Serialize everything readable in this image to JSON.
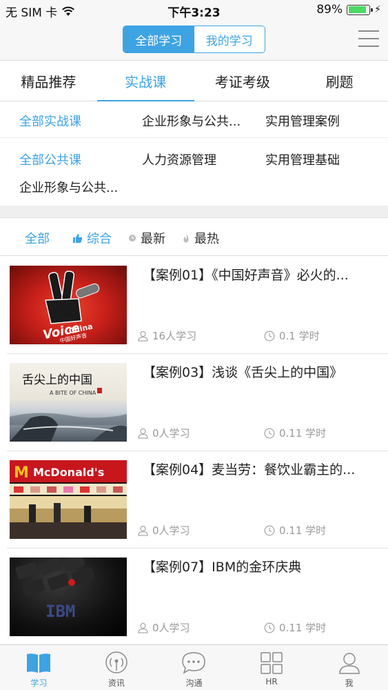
{
  "status_bar": {
    "carrier": "无 SIM 卡",
    "time": "下午3:23",
    "battery_percent": "89%",
    "battery_level": 0.89
  },
  "header": {
    "segment_all": "全部学习",
    "segment_mine": "我的学习",
    "menu_icon": "hamburger-icon"
  },
  "tabs": [
    {
      "label": "精品推荐"
    },
    {
      "label": "实战课"
    },
    {
      "label": "考证考级"
    },
    {
      "label": "刷题"
    }
  ],
  "subcategories": {
    "row1": [
      "全部实战课",
      "企业形象与公共...",
      "实用管理案例"
    ],
    "row2": [
      "全部公共课",
      "人力资源管理",
      "实用管理基础"
    ],
    "row3": [
      "企业形象与公共..."
    ]
  },
  "sort": {
    "all": "全部",
    "comprehensive": "综合",
    "newest": "最新",
    "hottest": "最热"
  },
  "courses": [
    {
      "title": "【案例01】《中国好声音》必火的...",
      "learners": "16人学习",
      "hours": "0.1 学时"
    },
    {
      "title": "【案例03】浅谈《舌尖上的中国》",
      "learners": "0人学习",
      "hours": "0.11 学时"
    },
    {
      "title": "【案例04】麦当劳：餐饮业霸主的...",
      "learners": "0人学习",
      "hours": "0.11 学时"
    },
    {
      "title": "【案例07】IBM的金环庆典",
      "learners": "0人学习",
      "hours": "0.11 学时"
    }
  ],
  "thumbs": {
    "voice_line1": "Voice",
    "voice_line2": "China",
    "voice_sub": "中国好声音",
    "bite_title": "舌尖上的中国",
    "bite_sub": "A BITE OF CHINA",
    "mcd_text": "McDonald's",
    "ibm_text": "IBM"
  },
  "tabbar": [
    {
      "label": "学习",
      "icon": "book-icon"
    },
    {
      "label": "资讯",
      "icon": "broadcast-icon"
    },
    {
      "label": "沟通",
      "icon": "chat-bubble-icon"
    },
    {
      "label": "HR",
      "icon": "grid-icon"
    },
    {
      "label": "我",
      "icon": "person-icon"
    }
  ],
  "colors": {
    "accent": "#3ea3e3",
    "gray_text": "#9a9a9a",
    "battery_green": "#4cd964"
  }
}
